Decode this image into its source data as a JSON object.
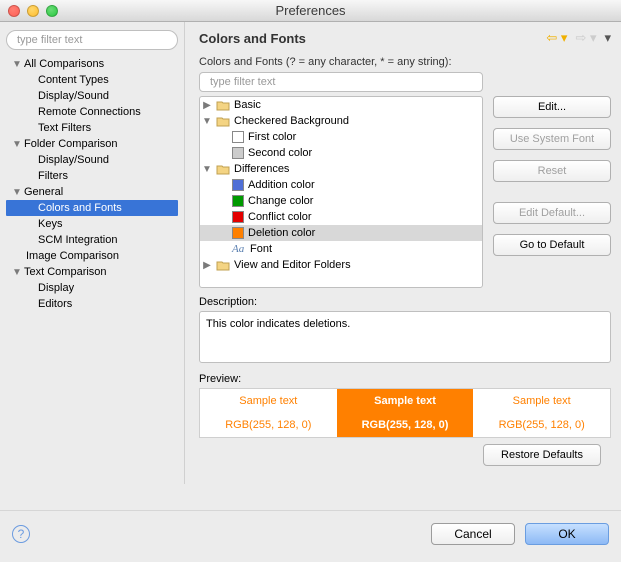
{
  "window_title": "Preferences",
  "filter_placeholder": "type filter text",
  "sidebar": {
    "s0": "All Comparisons",
    "s0a": "Content Types",
    "s0b": "Display/Sound",
    "s0c": "Remote Connections",
    "s0d": "Text Filters",
    "s1": "Folder Comparison",
    "s1a": "Display/Sound",
    "s1b": "Filters",
    "s2": "General",
    "s2a": "Colors and Fonts",
    "s2b": "Keys",
    "s2c": "SCM Integration",
    "s3": "Image Comparison",
    "s4": "Text Comparison",
    "s4a": "Display",
    "s4b": "Editors"
  },
  "header_title": "Colors and Fonts",
  "hint": "Colors and Fonts (? = any character, * = any string):",
  "inner_filter_placeholder": "type filter text",
  "tree": {
    "basic": "Basic",
    "checkered": "Checkered Background",
    "first": "First color",
    "second": "Second color",
    "diff": "Differences",
    "add": "Addition color",
    "chg": "Change color",
    "conf": "Conflict color",
    "del": "Deletion color",
    "font": "Font",
    "view": "View and Editor Folders"
  },
  "colors": {
    "first": "#ffffff",
    "second": "#cccccc",
    "add": "#4f6fd6",
    "chg": "#009a00",
    "conf": "#e30000",
    "del": "#ff8000"
  },
  "buttons": {
    "edit": "Edit...",
    "sysfont": "Use System Font",
    "reset": "Reset",
    "editdef": "Edit Default...",
    "godef": "Go to Default",
    "restore": "Restore Defaults",
    "cancel": "Cancel",
    "ok": "OK"
  },
  "desc_label": "Description:",
  "desc_text": "This color indicates deletions.",
  "prev_label": "Preview:",
  "preview": {
    "sample": "Sample text",
    "rgb": "RGB(255, 128, 0)"
  }
}
